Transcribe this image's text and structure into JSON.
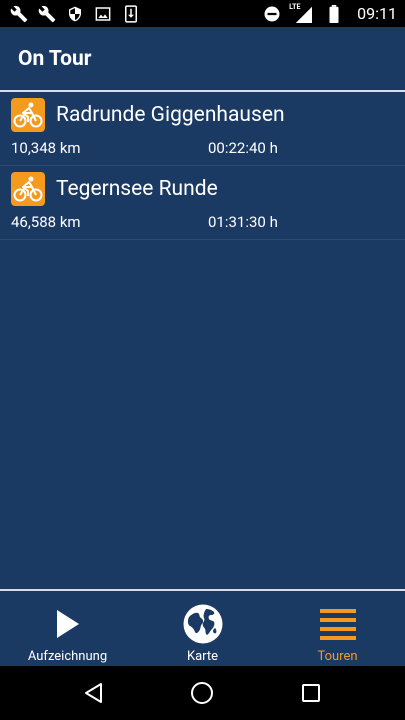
{
  "status_bar": {
    "icons": [
      "wrench-icon",
      "wrench-icon",
      "shield-icon",
      "image-icon",
      "download-icon",
      "do-not-disturb-icon",
      "lte-signal-icon",
      "battery-icon"
    ],
    "network_label": "LTE",
    "time": "09:11"
  },
  "app_bar": {
    "title": "On Tour"
  },
  "tours": [
    {
      "name": "Radrunde Giggenhausen",
      "distance": "10,348 km",
      "duration": "00:22:40 h",
      "icon": "bicycle-icon"
    },
    {
      "name": "Tegernsee Runde",
      "distance": "46,588 km",
      "duration": "01:31:30 h",
      "icon": "bicycle-icon"
    }
  ],
  "bottom_nav": {
    "items": [
      {
        "label": "Aufzeichnung",
        "icon": "play-icon",
        "active": false
      },
      {
        "label": "Karte",
        "icon": "globe-icon",
        "active": false
      },
      {
        "label": "Touren",
        "icon": "list-icon",
        "active": true
      }
    ]
  },
  "colors": {
    "background": "#1b3a63",
    "accent": "#f39a1f",
    "status_bar": "#000000"
  }
}
